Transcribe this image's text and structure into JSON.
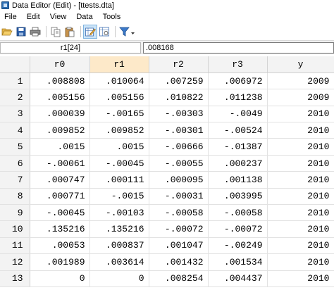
{
  "window": {
    "title": "Data Editor (Edit) - [ttests.dta]"
  },
  "menu": [
    "File",
    "Edit",
    "View",
    "Data",
    "Tools"
  ],
  "toolbar": {
    "icons": [
      "open-icon",
      "save-icon",
      "print-icon",
      "copy-icon",
      "paste-icon",
      "edit-icon",
      "browse-icon",
      "filter-icon"
    ]
  },
  "editbar": {
    "cell_ref": "r1[24]",
    "cell_value": ".008168"
  },
  "grid": {
    "columns": [
      "r0",
      "r1",
      "r2",
      "r3",
      "y"
    ],
    "rows": [
      [
        "1",
        ".008808",
        ".010064",
        ".007259",
        ".006972",
        "2009"
      ],
      [
        "2",
        ".005156",
        ".005156",
        ".010822",
        ".011238",
        "2009"
      ],
      [
        "3",
        ".000039",
        "-.00165",
        "-.00303",
        "-.0049",
        "2010"
      ],
      [
        "4",
        ".009852",
        ".009852",
        "-.00301",
        "-.00524",
        "2010"
      ],
      [
        "5",
        ".0015",
        ".0015",
        "-.00666",
        "-.01387",
        "2010"
      ],
      [
        "6",
        "-.00061",
        "-.00045",
        "-.00055",
        ".000237",
        "2010"
      ],
      [
        "7",
        ".000747",
        ".000111",
        ".000095",
        ".001138",
        "2010"
      ],
      [
        "8",
        ".000771",
        "-.0015",
        "-.00031",
        ".003995",
        "2010"
      ],
      [
        "9",
        "-.00045",
        "-.00103",
        "-.00058",
        "-.00058",
        "2010"
      ],
      [
        "10",
        ".135216",
        ".135216",
        "-.00072",
        "-.00072",
        "2010"
      ],
      [
        "11",
        ".00053",
        ".000837",
        ".001047",
        "-.00249",
        "2010"
      ],
      [
        "12",
        ".001989",
        ".003614",
        ".001432",
        ".001534",
        "2010"
      ],
      [
        "13",
        "0",
        "0",
        ".008254",
        ".004437",
        "2010"
      ]
    ]
  }
}
